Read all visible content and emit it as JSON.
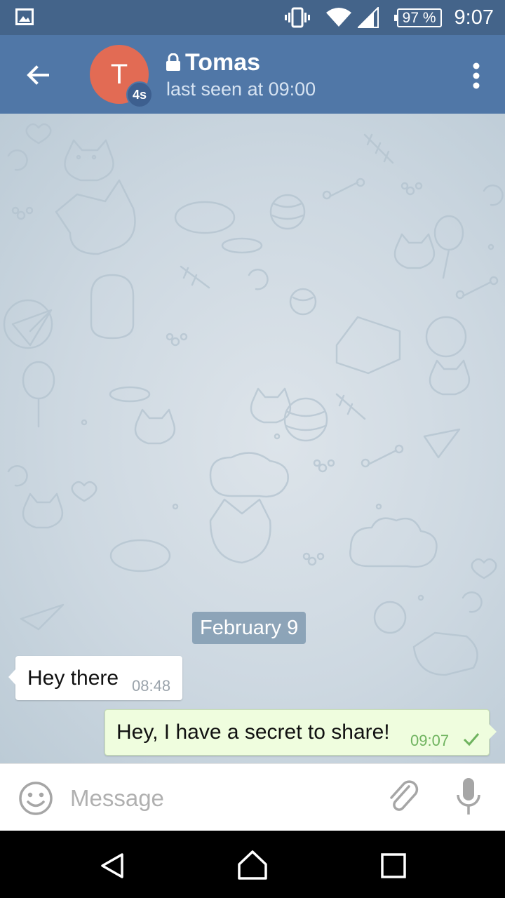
{
  "status_bar": {
    "battery": "97 %",
    "time": "9:07",
    "icons": [
      "image-icon",
      "vibrate-icon",
      "wifi-icon",
      "signal-icon",
      "battery-icon"
    ]
  },
  "header": {
    "avatar_letter": "T",
    "timer_badge": "4s",
    "title": "Tomas",
    "subtitle": "last seen at 09:00",
    "icons": [
      "back-arrow-icon",
      "lock-icon",
      "more-vert-icon"
    ]
  },
  "chat": {
    "date_divider": "February 9",
    "messages": [
      {
        "direction": "incoming",
        "text": "Hey there",
        "time": "08:48"
      },
      {
        "direction": "outgoing",
        "text": "Hey, I have a secret to share!",
        "time": "09:07",
        "status": "sent"
      }
    ]
  },
  "input_bar": {
    "placeholder": "Message",
    "icons": [
      "emoji-icon",
      "attach-icon",
      "mic-icon"
    ]
  },
  "nav_bar": {
    "icons": [
      "nav-back-icon",
      "nav-home-icon",
      "nav-recents-icon"
    ]
  },
  "colors": {
    "status_bar": "#44648a",
    "action_bar": "#5077a7",
    "avatar": "#e26b54",
    "outgoing_bubble": "#effdde",
    "incoming_bubble": "#ffffff",
    "check": "#6fb35f"
  }
}
